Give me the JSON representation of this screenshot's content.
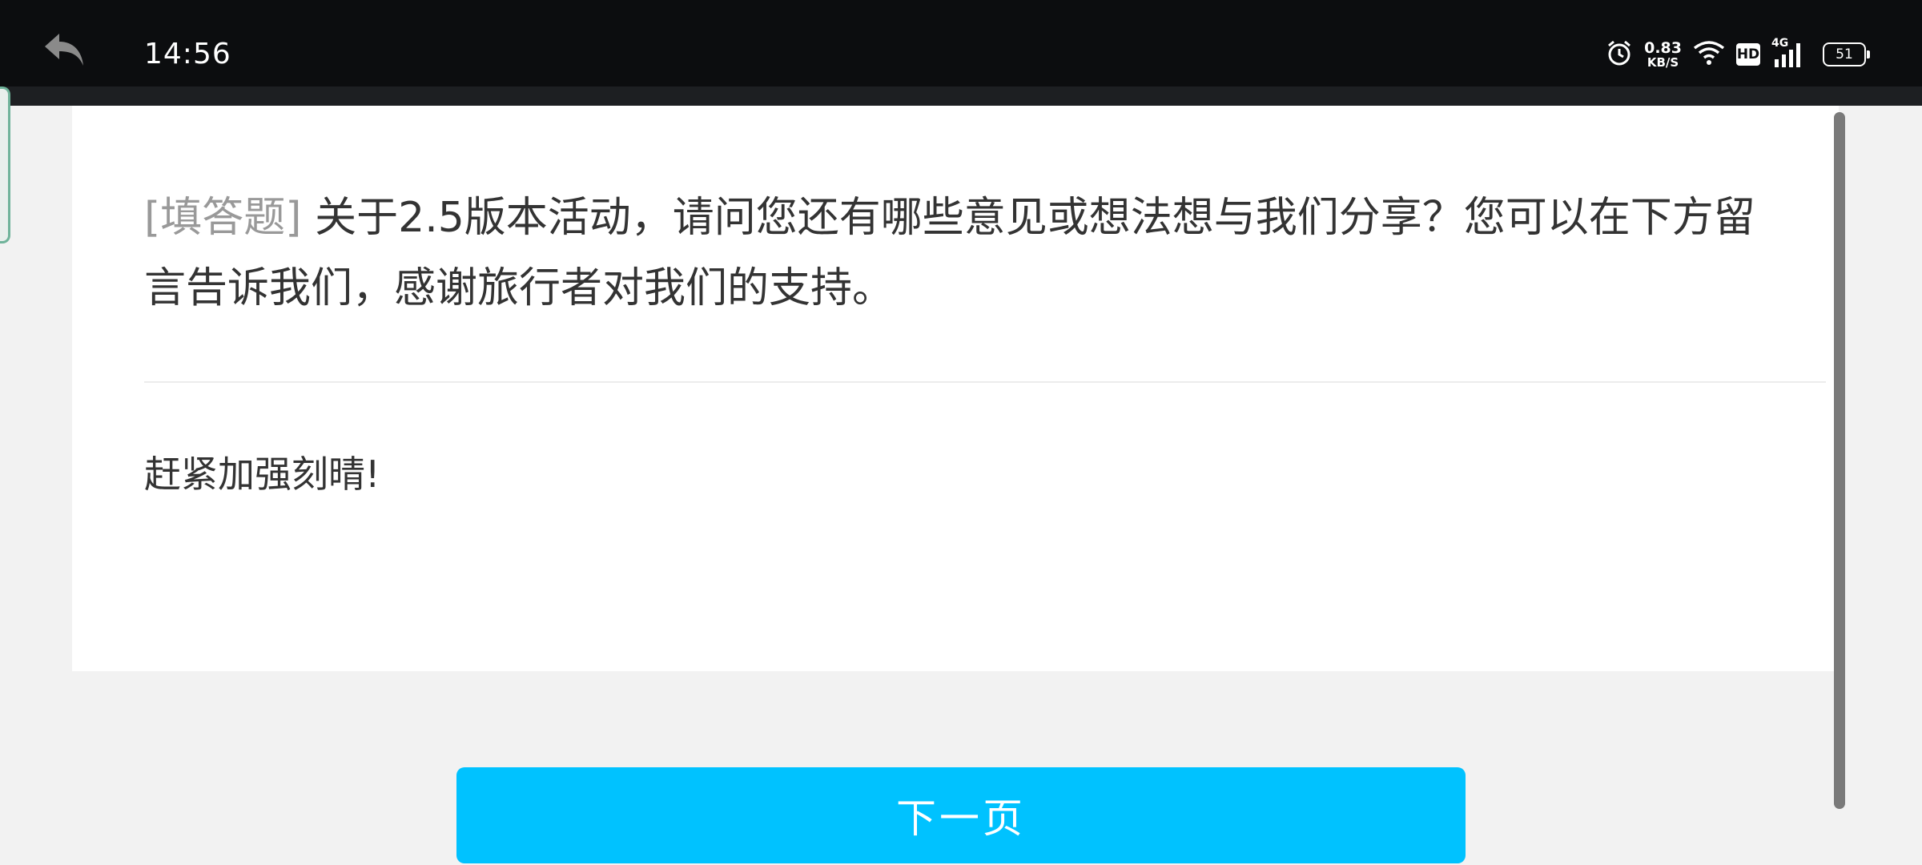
{
  "status_bar": {
    "time": "14:56",
    "net_speed_value": "0.83",
    "net_speed_unit": "KB/S",
    "hd_label": "HD",
    "network_type": "4G",
    "battery_level": "51"
  },
  "question": {
    "type_label": "[填答题]",
    "text": " 关于2.5版本活动，请问您还有哪些意见或想法想与我们分享？您可以在下方留言告诉我们，感谢旅行者对我们的支持。"
  },
  "answer": {
    "value": "赶紧加强刻晴!"
  },
  "footer": {
    "next_label": "下一页"
  },
  "colors": {
    "accent": "#00c2ff",
    "status_bar_bg": "#0c0d0f",
    "page_bg": "#f2f2f2"
  },
  "icons": [
    "back-arrow-icon",
    "alarm-icon",
    "wifi-icon",
    "signal-icon",
    "battery-icon"
  ]
}
